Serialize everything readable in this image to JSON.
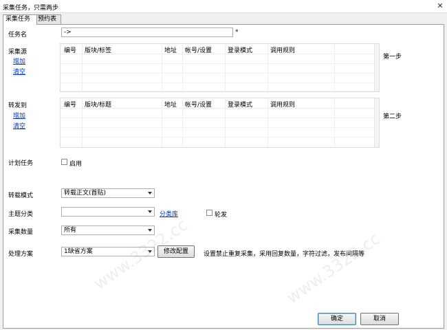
{
  "window": {
    "title": "采集任务，只需两步"
  },
  "tabs": [
    {
      "label": "采集任务",
      "active": true
    },
    {
      "label": "预约表",
      "active": false
    }
  ],
  "task_name": {
    "label": "任务名",
    "value": "->",
    "required_mark": "*"
  },
  "source": {
    "label": "采集源",
    "add": "增加",
    "clear": "清空",
    "step": "第一步",
    "columns": [
      "编号",
      "版块/标签",
      "地址",
      "帐号/设置",
      "登录模式",
      "调用规则"
    ]
  },
  "forward": {
    "label": "转发到",
    "add": "增加",
    "clear": "清空",
    "step": "第二步",
    "columns": [
      "编号",
      "版块/标题",
      "地址",
      "帐号/设置",
      "登录模式",
      "调用规则"
    ]
  },
  "schedule": {
    "label": "计划任务",
    "checkbox_label": "启用"
  },
  "repost_mode": {
    "label": "转载模式",
    "value": "转载正文(首贴)"
  },
  "topic_category": {
    "label": "主题分类",
    "value": "",
    "link": "分类库",
    "checkbox_label": "轮发"
  },
  "collect_count": {
    "label": "采集数量",
    "value": "所有"
  },
  "process_plan": {
    "label": "处理方案",
    "value": "1缺省方案",
    "edit_button": "修改配置",
    "description": "设置禁止重复采集，采用回复数量，字符过滤，发布间隔等"
  },
  "footer": {
    "ok": "确定",
    "cancel": "取消"
  },
  "watermark": "www.3322.cc"
}
